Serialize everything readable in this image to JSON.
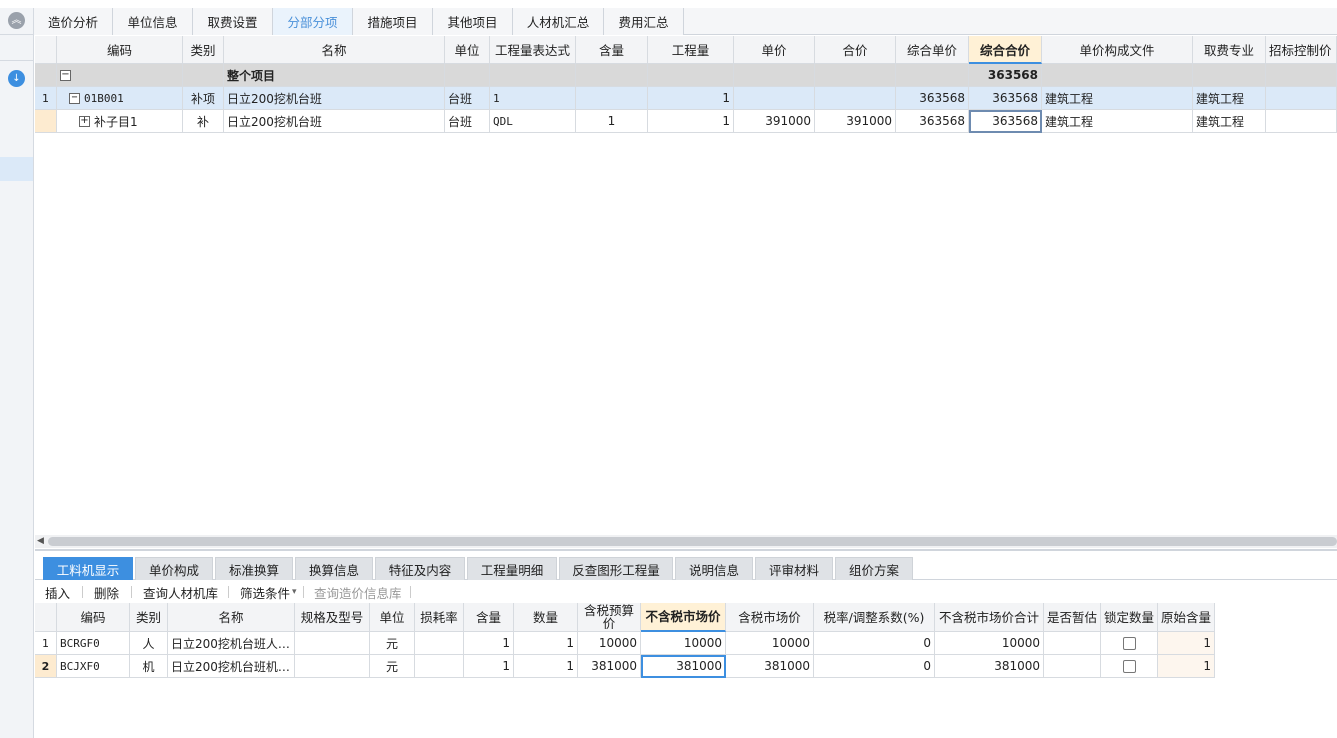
{
  "top_tabs": [
    {
      "label": "造价分析"
    },
    {
      "label": "单位信息"
    },
    {
      "label": "取费设置"
    },
    {
      "label": "分部分项"
    },
    {
      "label": "措施项目"
    },
    {
      "label": "其他项目"
    },
    {
      "label": "人材机汇总"
    },
    {
      "label": "费用汇总"
    }
  ],
  "active_top_tab": "分部分项",
  "grid1": {
    "headers": [
      "编码",
      "类别",
      "名称",
      "单位",
      "工程量表达式",
      "含量",
      "工程量",
      "单价",
      "合价",
      "综合单价",
      "综合合价",
      "单价构成文件",
      "取费专业",
      "招标控制价"
    ],
    "group_row": {
      "expand": "−",
      "name": "整个项目",
      "total": "363568"
    },
    "rows": [
      {
        "num": "1",
        "expand": "−",
        "code": "01B001",
        "type": "补项",
        "name": "日立200挖机台班",
        "unit": "台班",
        "expr": "1",
        "qty_ratio": "",
        "quantity": "1",
        "unit_price": "",
        "total_price": "",
        "comp_unit_price": "363568",
        "comp_total": "363568",
        "price_file": "建筑工程",
        "fee_type": "建筑工程"
      },
      {
        "num": "",
        "expand": "+",
        "code": "补子目1",
        "type": "补",
        "name": "日立200挖机台班",
        "unit": "台班",
        "expr": "QDL",
        "qty_ratio": "1",
        "quantity": "1",
        "unit_price": "391000",
        "total_price": "391000",
        "comp_unit_price": "363568",
        "comp_total": "363568",
        "price_file": "建筑工程",
        "fee_type": "建筑工程"
      }
    ]
  },
  "bottom_tabs": [
    {
      "label": "工料机显示"
    },
    {
      "label": "单价构成"
    },
    {
      "label": "标准换算"
    },
    {
      "label": "换算信息"
    },
    {
      "label": "特征及内容"
    },
    {
      "label": "工程量明细"
    },
    {
      "label": "反查图形工程量"
    },
    {
      "label": "说明信息"
    },
    {
      "label": "评审材料"
    },
    {
      "label": "组价方案"
    }
  ],
  "active_bottom_tab": "工料机显示",
  "toolbar": {
    "insert": "插入",
    "delete": "删除",
    "query_lib": "查询人材机库",
    "filter": "筛选条件",
    "filter_arrow": "▾",
    "query_price": "查询造价信息库"
  },
  "grid2": {
    "headers": [
      "编码",
      "类别",
      "名称",
      "规格及型号",
      "单位",
      "损耗率",
      "含量",
      "数量",
      "含税预算价",
      "不含税市场价",
      "含税市场价",
      "税率/调整系数(%)",
      "不含税市场价合计",
      "是否暂估",
      "锁定数量",
      "原始含量"
    ],
    "rows": [
      {
        "num": "1",
        "code": "BCRGF0",
        "type": "人",
        "name": "日立200挖机台班人…",
        "spec": "",
        "unit": "元",
        "loss": "",
        "ratio": "1",
        "qty": "1",
        "tax_budget": "10000",
        "notax_market": "10000",
        "tax_market": "10000",
        "rate": "0",
        "notax_total": "10000",
        "provisional": "",
        "locked": false,
        "orig_ratio": "1"
      },
      {
        "num": "2",
        "code": "BCJXF0",
        "type": "机",
        "name": "日立200挖机台班机…",
        "spec": "",
        "unit": "元",
        "loss": "",
        "ratio": "1",
        "qty": "1",
        "tax_budget": "381000",
        "notax_market": "381000",
        "tax_market": "381000",
        "rate": "0",
        "notax_total": "381000",
        "provisional": "",
        "locked": false,
        "orig_ratio": "1"
      }
    ]
  },
  "icons": {
    "collapse": "double-chevron-up-icon",
    "download": "download-arrow-icon"
  },
  "colors": {
    "accent": "#3d8fe0",
    "highlight_header": "#fff1d6",
    "selected_row": "#dbe9f8",
    "group_row": "#d9d9d9"
  }
}
